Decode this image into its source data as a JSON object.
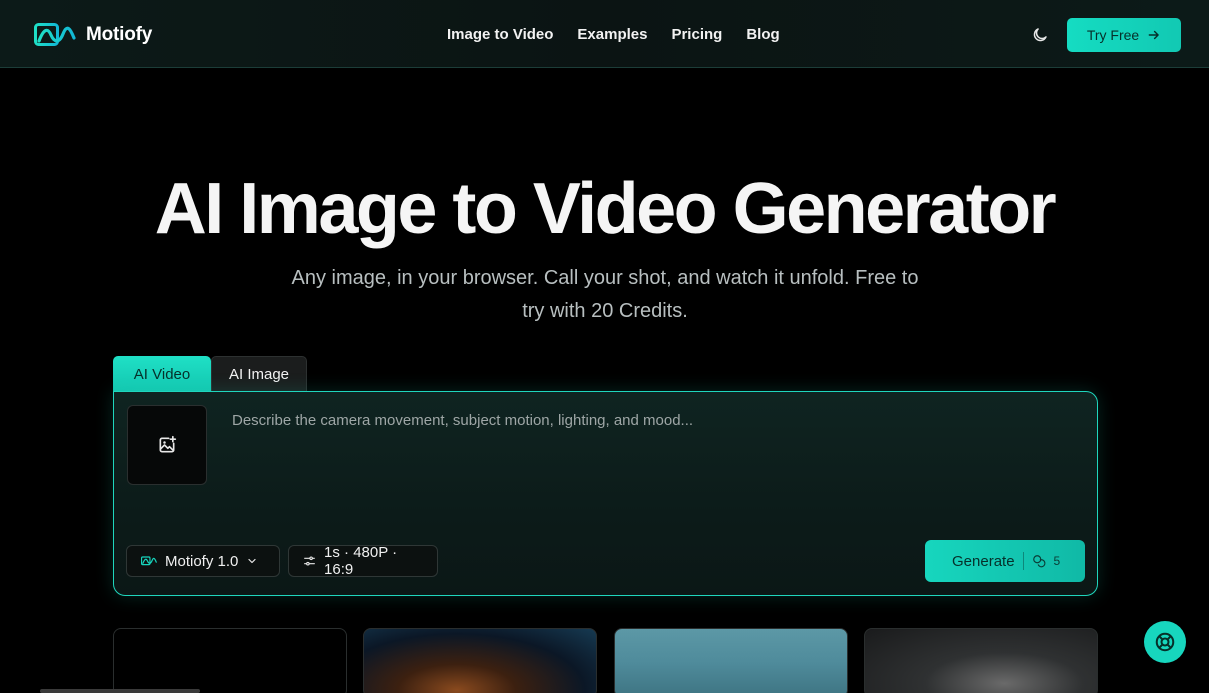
{
  "header": {
    "brand": "Motiofy",
    "nav": [
      "Image to Video",
      "Examples",
      "Pricing",
      "Blog"
    ],
    "cta_label": "Try Free"
  },
  "hero": {
    "title": "AI Image to Video Generator",
    "subtitle_line1": "Any image, in your browser. Call your shot, and watch it unfold. Free to",
    "subtitle_line2": "try with 20 Credits."
  },
  "tabs": [
    {
      "label": "AI Video",
      "active": true
    },
    {
      "label": "AI Image",
      "active": false
    }
  ],
  "composer": {
    "prompt_placeholder": "Describe the camera movement, subject motion, lighting, and mood...",
    "model_label": "Motiofy 1.0",
    "settings_label": "1s · 480P · 16:9",
    "generate_label": "Generate",
    "credit_cost": "5"
  },
  "colors": {
    "accent": "#17d6be",
    "background": "#000000",
    "panel": "#0f2421"
  },
  "icons": {
    "upload": "image-plus-icon",
    "theme": "moon-icon",
    "help": "lifebuoy-icon"
  }
}
